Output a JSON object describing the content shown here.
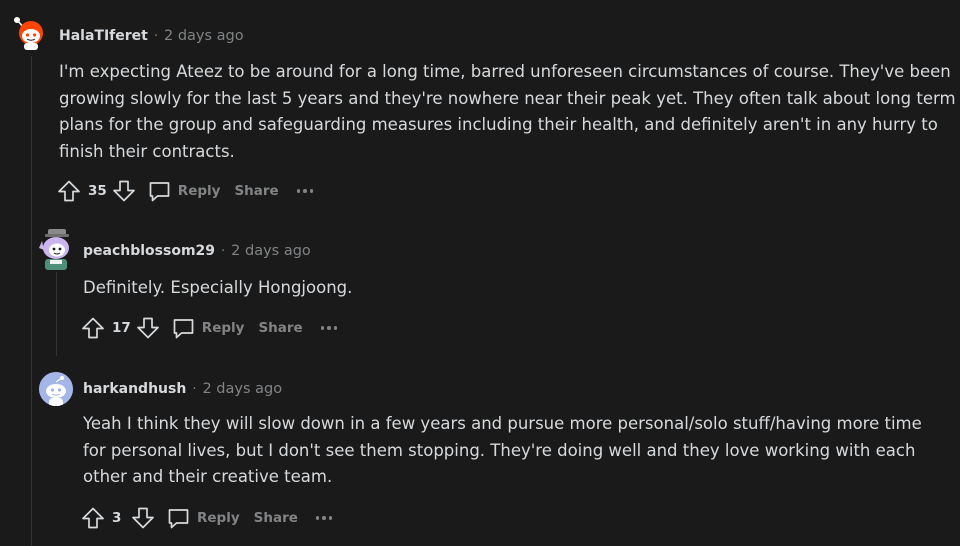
{
  "comments": [
    {
      "username": "HalaTIferet",
      "separator": "·",
      "time": "2 days ago",
      "lines": [
        "I'm expecting Ateez to be around for a long time, barred unforeseen circumstances of course. They've been",
        "growing slowly for the last 5 years and they're nowhere near their peak yet. They often talk about long term",
        "plans for the group and safeguarding measures including their health, and definitely aren't in any hurry to",
        "finish their contracts."
      ],
      "score": "35",
      "reply_label": "Reply",
      "share_label": "Share",
      "avatar": "snoo-red-antenna-avatar"
    },
    {
      "username": "peachblossom29",
      "separator": "·",
      "time": "2 days ago",
      "lines": [
        "Definitely. Especially Hongjoong."
      ],
      "score": "17",
      "reply_label": "Reply",
      "share_label": "Share",
      "avatar": "snoo-lavender-hat-avatar"
    },
    {
      "username": "harkandhush",
      "separator": "·",
      "time": "2 days ago",
      "lines": [
        "Yeah I think they will slow down in a few years and pursue more personal/solo stuff/having more time",
        "for personal lives, but I don't see them stopping. They're doing well and they love working with each",
        "other and their creative team."
      ],
      "score": "3",
      "reply_label": "Reply",
      "share_label": "Share",
      "avatar": "snoo-default-blue-avatar"
    }
  ],
  "colors": {
    "background": "#1a1a1b",
    "text": "#d7dadc",
    "muted": "#818384",
    "thread_line": "#343536"
  }
}
